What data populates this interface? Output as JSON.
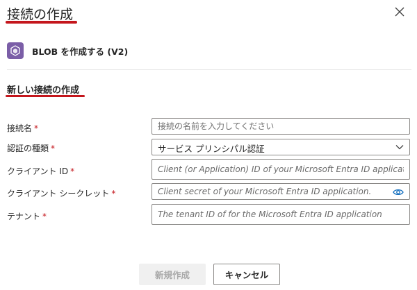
{
  "dialog": {
    "title": "接続の作成",
    "connector_label": "BLOB を作成する (V2)",
    "section_title": "新しい接続の作成"
  },
  "form": {
    "required_mark": "*",
    "connection_name": {
      "label": "接続名",
      "placeholder": "接続の名前を入力してください"
    },
    "auth_type": {
      "label": "認証の種類",
      "selected": "サービス プリンシパル認証"
    },
    "client_id": {
      "label": "クライアント ID",
      "placeholder": "Client (or Application) ID of your Microsoft Entra ID application."
    },
    "client_secret": {
      "label": "クライアント シークレット",
      "placeholder": "Client secret of your Microsoft Entra ID application."
    },
    "tenant": {
      "label": "テナント",
      "placeholder": "The tenant ID of for the Microsoft Entra ID application"
    }
  },
  "buttons": {
    "create": "新規作成",
    "cancel": "キャンセル"
  },
  "colors": {
    "accent_underline": "#c4161c",
    "connector_icon_bg": "#7b5ea7",
    "eye_icon": "#0f6cbd"
  },
  "icons": [
    "close-icon",
    "blob-connector-icon",
    "chevron-down-icon",
    "eye-icon"
  ]
}
